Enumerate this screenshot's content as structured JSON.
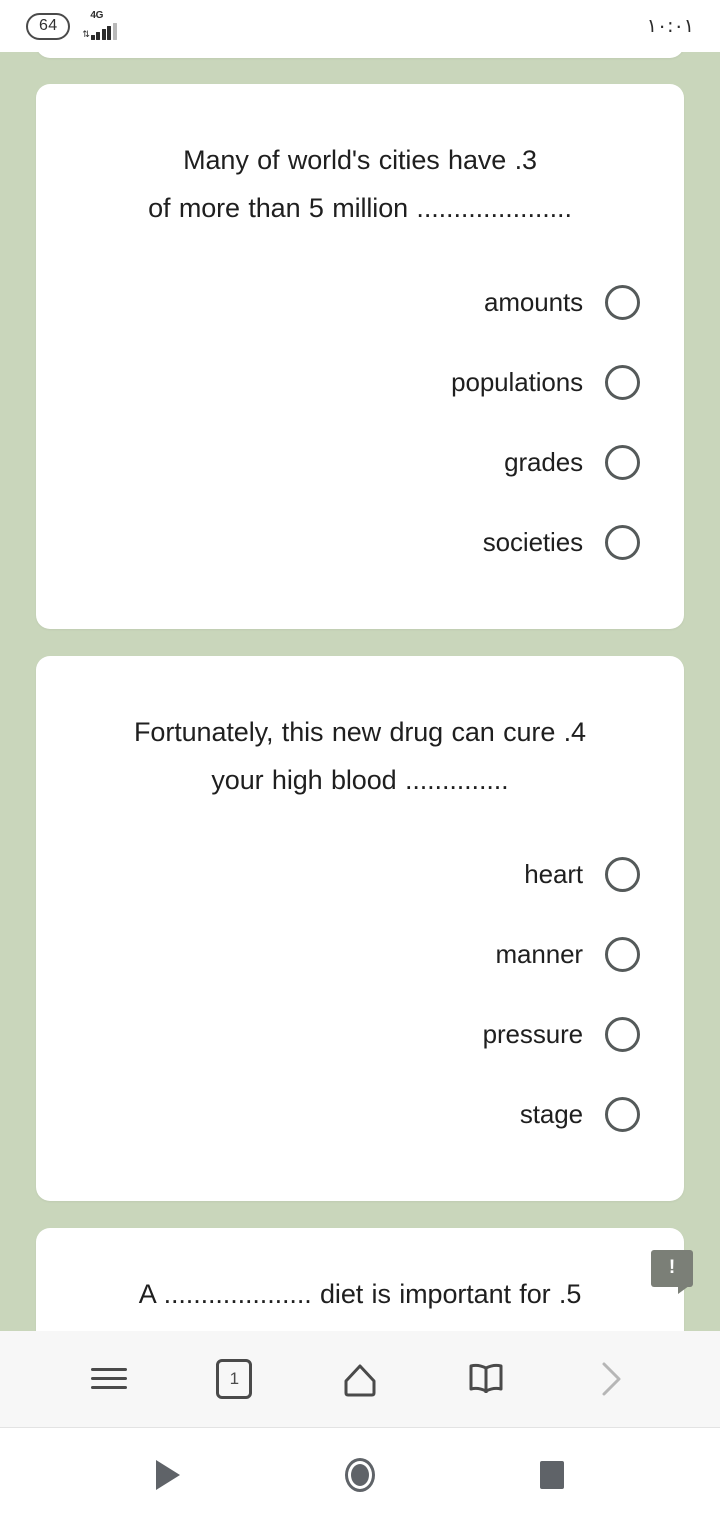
{
  "status_bar": {
    "battery_level": "64",
    "network_type": "4G",
    "signal_icon": "signal-bars-icon",
    "data_arrows_icon": "data-transfer-arrows-icon",
    "clock": "۱۰:۰۱"
  },
  "page": {
    "background_color": "#c9d6bb",
    "card_color": "#ffffff",
    "cards": [
      {
        "id": "previous-question-card",
        "question": "",
        "options": []
      },
      {
        "id": "question-3",
        "number": "3",
        "question": "Many of world's cities have .3",
        "question_line_1": "Many of world's cities have .3",
        "question_line_2": "..................... of more than 5 million",
        "options": [
          {
            "label": "amounts",
            "selected": false
          },
          {
            "label": "populations",
            "selected": false
          },
          {
            "label": "grades",
            "selected": false
          },
          {
            "label": "societies",
            "selected": false
          }
        ]
      },
      {
        "id": "question-4",
        "number": "4",
        "question": "Fortunately, this new drug can cure .4",
        "question_line_1": "Fortunately, this new drug can cure .4",
        "question_line_2": ".............. your high blood",
        "options": [
          {
            "label": "heart",
            "selected": false
          },
          {
            "label": "manner",
            "selected": false
          },
          {
            "label": "pressure",
            "selected": false
          },
          {
            "label": "stage",
            "selected": false
          }
        ]
      },
      {
        "id": "question-5",
        "number": "5",
        "question_line_1": "A .................... diet is important for .5",
        "options": []
      }
    ],
    "report_badge": {
      "icon": "exclamation-bubble-icon",
      "label": "!",
      "color": "#7b7f77"
    }
  },
  "browser_toolbar": {
    "background_color": "#f7f7f7",
    "buttons": [
      {
        "name": "menu-button",
        "icon": "hamburger-menu-icon",
        "label": ""
      },
      {
        "name": "tab-switcher-button",
        "icon": "tab-count-icon",
        "label": "1"
      },
      {
        "name": "home-button",
        "icon": "home-icon",
        "label": ""
      },
      {
        "name": "bookmarks-button",
        "icon": "open-book-icon",
        "label": ""
      },
      {
        "name": "forward-button",
        "icon": "chevron-right-icon",
        "label": ""
      }
    ]
  },
  "android_navbar": {
    "background_color": "#ffffff",
    "buttons": [
      {
        "name": "back-button",
        "icon": "triangle-back-icon"
      },
      {
        "name": "home-button",
        "icon": "circle-home-icon"
      },
      {
        "name": "recents-button",
        "icon": "square-recents-icon"
      }
    ]
  }
}
